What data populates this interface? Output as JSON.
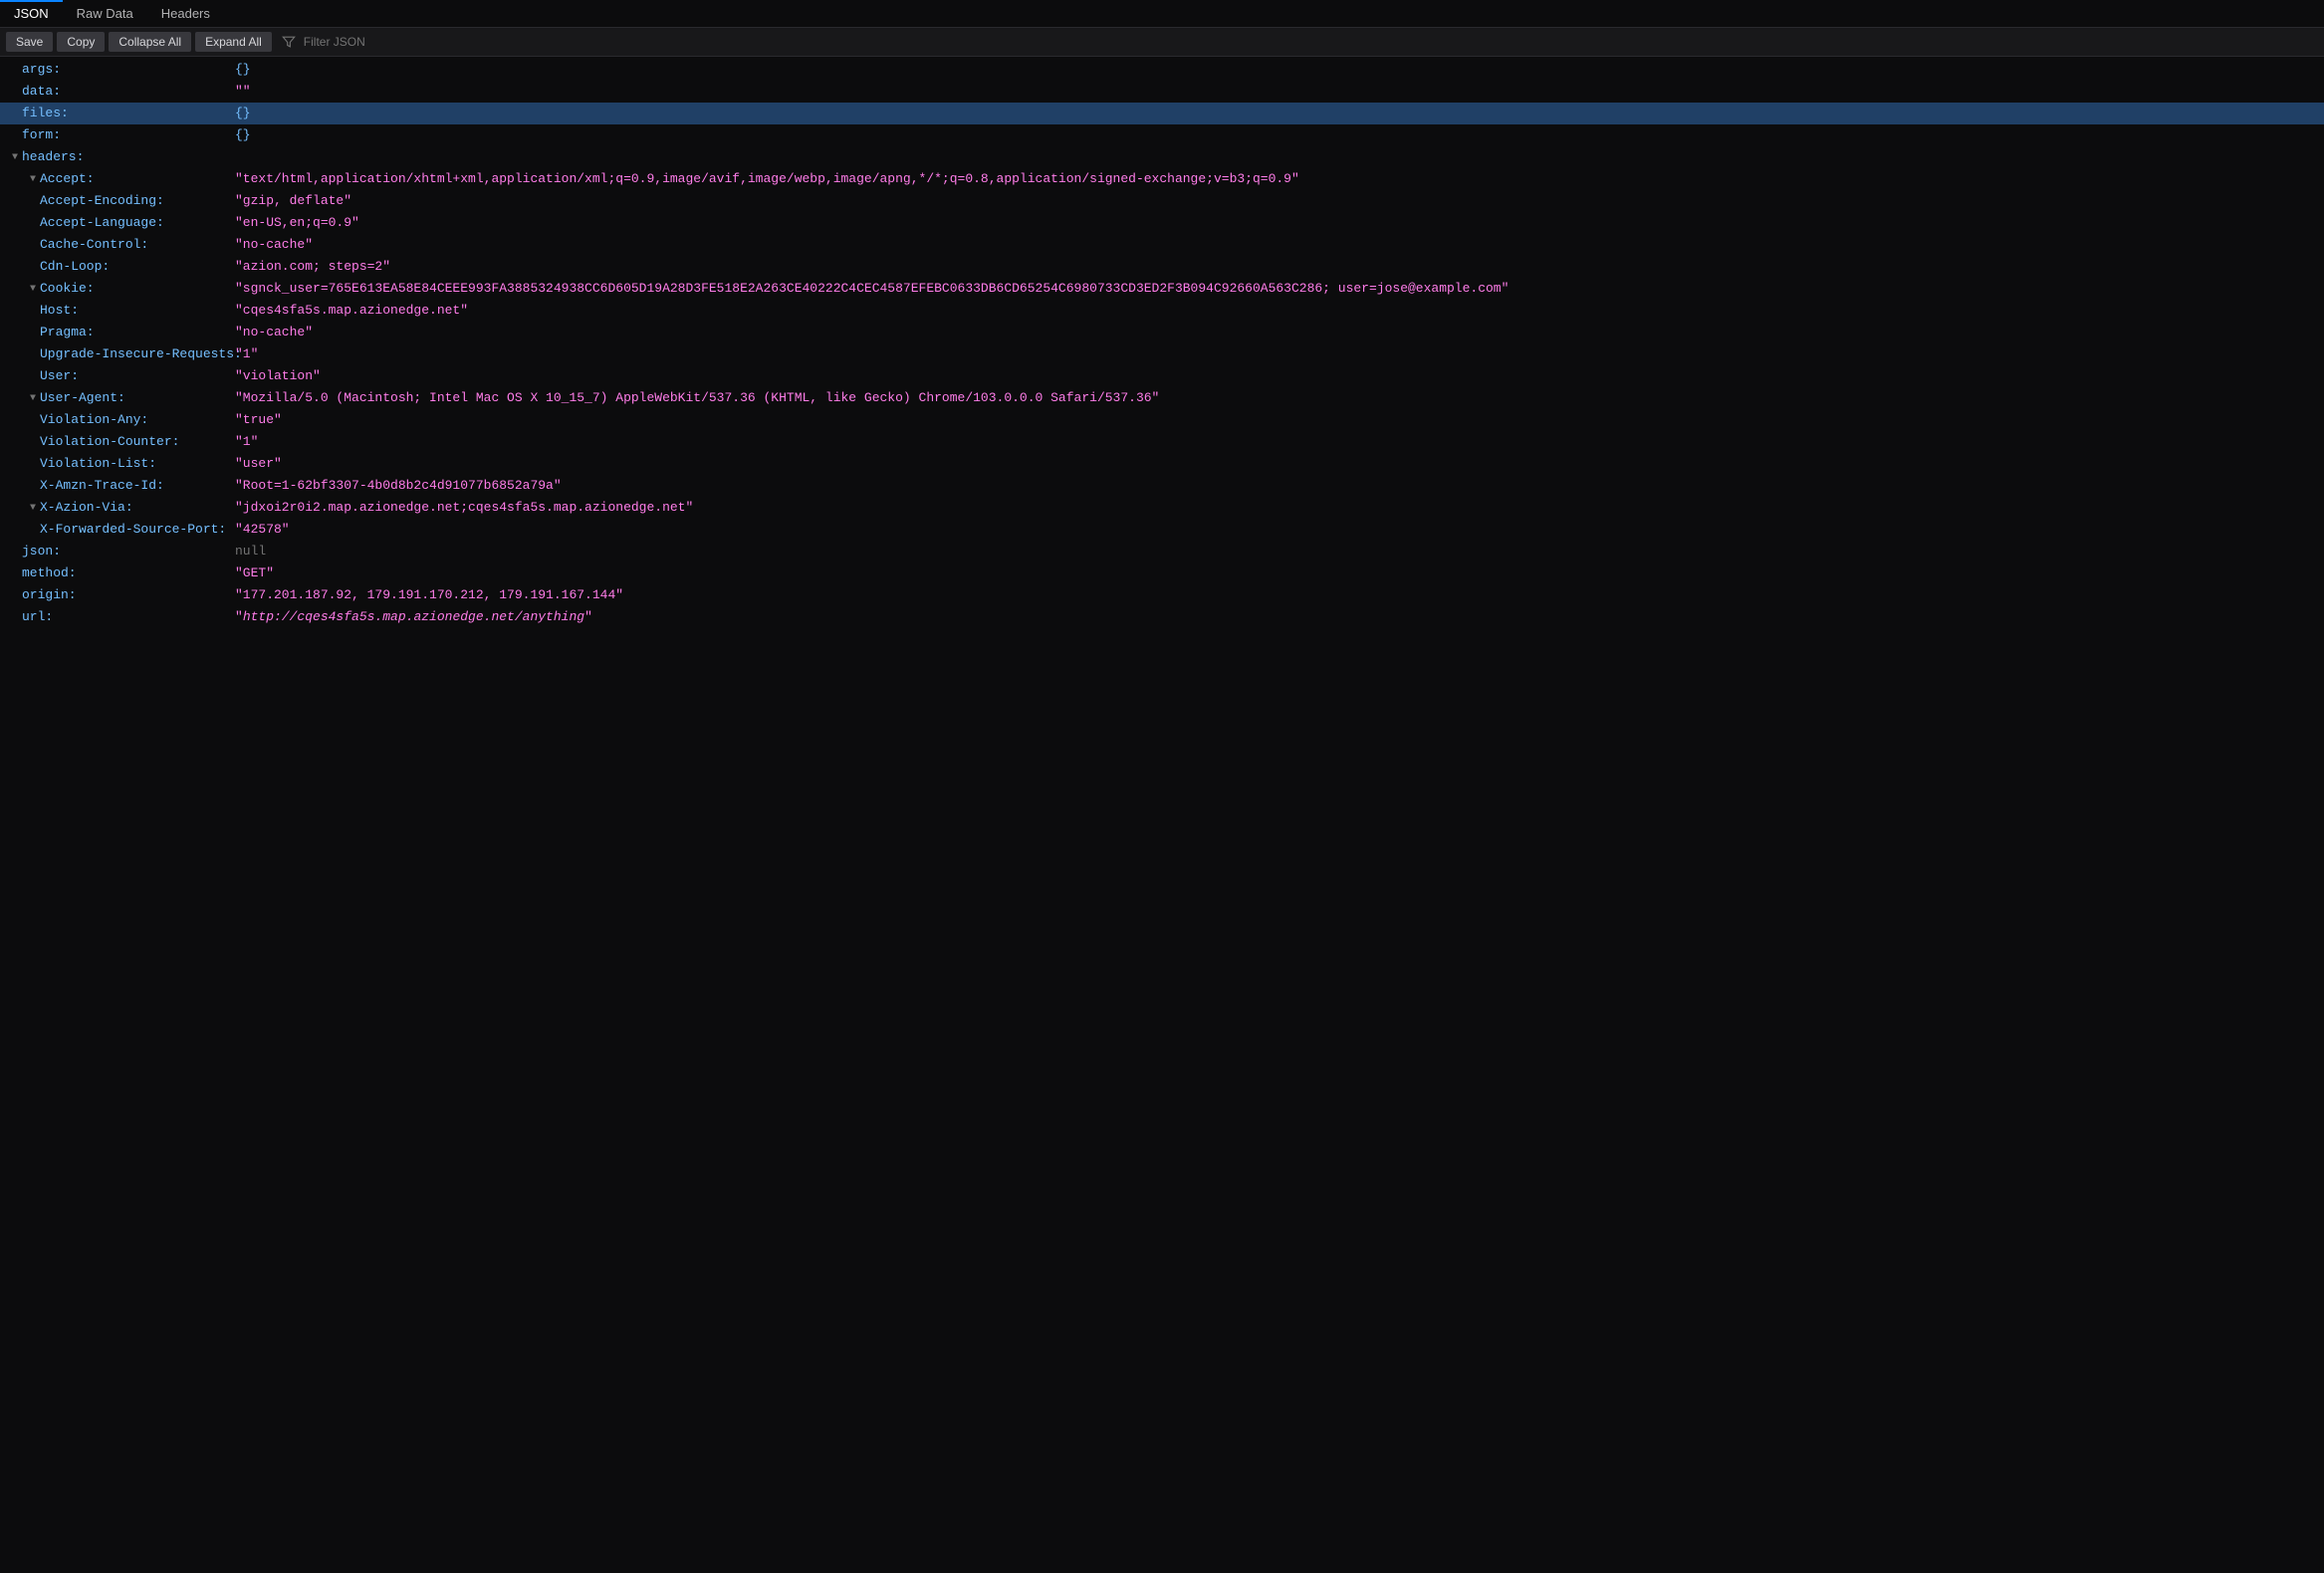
{
  "tabs": {
    "json": "JSON",
    "raw": "Raw Data",
    "headers": "Headers"
  },
  "toolbar": {
    "save": "Save",
    "copy": "Copy",
    "collapse_all": "Collapse All",
    "expand_all": "Expand All",
    "filter_placeholder": "Filter JSON"
  },
  "rows": {
    "args": {
      "key": "args:",
      "val": "{}"
    },
    "data": {
      "key": "data:",
      "val": "\"\""
    },
    "files": {
      "key": "files:",
      "val": "{}"
    },
    "form": {
      "key": "form:",
      "val": "{}"
    },
    "headers": {
      "key": "headers:"
    },
    "Accept": {
      "key": "Accept:",
      "val": "\"text/html,application/xhtml+xml,application/xml;q=0.9,image/avif,image/webp,image/apng,*/*;q=0.8,application/signed-exchange;v=b3;q=0.9\""
    },
    "AcceptEncoding": {
      "key": "Accept-Encoding:",
      "val": "\"gzip, deflate\""
    },
    "AcceptLanguage": {
      "key": "Accept-Language:",
      "val": "\"en-US,en;q=0.9\""
    },
    "CacheControl": {
      "key": "Cache-Control:",
      "val": "\"no-cache\""
    },
    "CdnLoop": {
      "key": "Cdn-Loop:",
      "val": "\"azion.com; steps=2\""
    },
    "Cookie": {
      "key": "Cookie:",
      "val": "\"sgnck_user=765E613EA58E84CEEE993FA3885324938CC6D605D19A28D3FE518E2A263CE40222C4CEC4587EFEBC0633DB6CD65254C6980733CD3ED2F3B094C92660A563C286; user=jose@example.com\""
    },
    "Host": {
      "key": "Host:",
      "val": "\"cqes4sfa5s.map.azionedge.net\""
    },
    "Pragma": {
      "key": "Pragma:",
      "val": "\"no-cache\""
    },
    "UpgradeInsecure": {
      "key": "Upgrade-Insecure-Requests:",
      "val": "\"1\""
    },
    "User": {
      "key": "User:",
      "val": "\"violation\""
    },
    "UserAgent": {
      "key": "User-Agent:",
      "val": "\"Mozilla/5.0 (Macintosh; Intel Mac OS X 10_15_7) AppleWebKit/537.36 (KHTML, like Gecko) Chrome/103.0.0.0 Safari/537.36\""
    },
    "ViolationAny": {
      "key": "Violation-Any:",
      "val": "\"true\""
    },
    "ViolationCounter": {
      "key": "Violation-Counter:",
      "val": "\"1\""
    },
    "ViolationList": {
      "key": "Violation-List:",
      "val": "\"user\""
    },
    "XAmznTraceId": {
      "key": "X-Amzn-Trace-Id:",
      "val": "\"Root=1-62bf3307-4b0d8b2c4d91077b6852a79a\""
    },
    "XAzionVia": {
      "key": "X-Azion-Via:",
      "val": "\"jdxoi2r0i2.map.azionedge.net;cqes4sfa5s.map.azionedge.net\""
    },
    "XForwardedSourcePort": {
      "key": "X-Forwarded-Source-Port:",
      "val": "\"42578\""
    },
    "json": {
      "key": "json:",
      "val": "null"
    },
    "method": {
      "key": "method:",
      "val": "\"GET\""
    },
    "origin": {
      "key": "origin:",
      "val": "\"177.201.187.92, 179.191.170.212, 179.191.167.144\""
    },
    "url": {
      "key": "url:",
      "q1": "\"",
      "val": "http://cqes4sfa5s.map.azionedge.net/anything",
      "q2": "\""
    }
  }
}
